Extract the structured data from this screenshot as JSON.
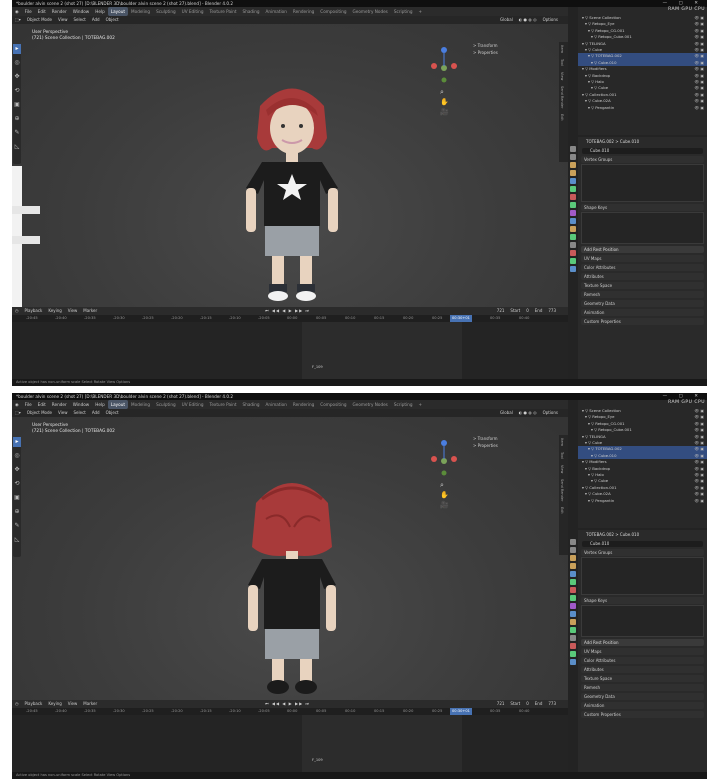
{
  "shots": [
    {
      "id": "shot1",
      "title": "*boulder alvin scene 2 (shot 27) [D:\\BLENDER 3D\\boulder alvin scene 2 (shot 27).blend] - Blender 4.0.2",
      "menu": [
        "File",
        "Edit",
        "Render",
        "Window",
        "Help"
      ],
      "workspaces": [
        "Layout",
        "Modeling",
        "Sculpting",
        "UV Editing",
        "Texture Paint",
        "Shading",
        "Animation",
        "Rendering",
        "Compositing",
        "Geometry Nodes",
        "Scripting",
        "+"
      ],
      "active_workspace": "Layout",
      "vp_header": {
        "mode": "Object Mode",
        "view": "View",
        "select": "Select",
        "add": "Add",
        "object": "Object",
        "transform": "Global",
        "options": "Options"
      },
      "perspective": "User Perspective",
      "collection": "(721) Scene Collection | TOTEBAG.002",
      "npanel": [
        "> Transform",
        "> Properties"
      ],
      "ntabs": [
        "Item",
        "Tool",
        "View",
        "Send Render",
        "Edit"
      ],
      "timeline": {
        "menu": [
          "Playback",
          "Keying",
          "View",
          "Marker"
        ],
        "current": "721",
        "start_label": "Start",
        "start": "0",
        "end_label": "End",
        "end": "773",
        "ticks": [
          "-20:45",
          "-20:40",
          "-20:35",
          "-20:30",
          "-20:25",
          "-20:20",
          "-20:15",
          "-20:10",
          "-20:05",
          "00:00",
          "00:05",
          "00:10",
          "00:15",
          "00:20",
          "00:25",
          "00:30",
          "00:35",
          "00:40"
        ],
        "playhead_label": "00:30+01",
        "marker": "F_109"
      },
      "status": "Active object has non-uniform scale   Select   Rotate View   Options",
      "perf": "RAM  GPU  CPU",
      "outliner": [
        "Scene Collection",
        "Retopo_Eye",
        "Retopo_CG.001",
        "Retopo_Cube.001",
        "TELINGA",
        "Cube",
        "TOTEBAG.002",
        "Cube.010",
        "Modifiers",
        "Backdrop",
        "Halo",
        "Cube",
        "Collection.001",
        "Cube.02A",
        "Pengantin"
      ],
      "breadcrumb": "TOTEBAG.002 > Cube.010",
      "mesh": "Cube.010",
      "panels": {
        "vertex_groups": "Vertex Groups",
        "shape_keys": "Shape Keys",
        "add_rest": "Add Rest Position",
        "uv": "UV Maps",
        "color": "Color Attributes",
        "attributes": "Attributes",
        "texture": "Texture Space",
        "remesh": "Remesh",
        "geometry": "Geometry Data",
        "animation": "Animation",
        "custom": "Custom Properties"
      }
    },
    {
      "id": "shot2",
      "title": "*boulder alvin scene 2 (shot 27) [D:\\BLENDER 3D\\boulder alvin scene 2 (shot 27).blend] - Blender 4.0.2",
      "menu": [
        "File",
        "Edit",
        "Render",
        "Window",
        "Help"
      ],
      "workspaces": [
        "Layout",
        "Modeling",
        "Sculpting",
        "UV Editing",
        "Texture Paint",
        "Shading",
        "Animation",
        "Rendering",
        "Compositing",
        "Geometry Nodes",
        "Scripting",
        "+"
      ],
      "active_workspace": "Layout",
      "vp_header": {
        "mode": "Object Mode",
        "view": "View",
        "select": "Select",
        "add": "Add",
        "object": "Object",
        "transform": "Global",
        "options": "Options"
      },
      "perspective": "User Perspective",
      "collection": "(721) Scene Collection | TOTEBAG.002",
      "npanel": [
        "> Transform",
        "> Properties"
      ],
      "ntabs": [
        "Item",
        "Tool",
        "View",
        "Send Render",
        "Edit"
      ],
      "timeline": {
        "menu": [
          "Playback",
          "Keying",
          "View",
          "Marker"
        ],
        "current": "721",
        "start_label": "Start",
        "start": "0",
        "end_label": "End",
        "end": "773",
        "ticks": [
          "-20:45",
          "-20:40",
          "-20:35",
          "-20:30",
          "-20:25",
          "-20:20",
          "-20:15",
          "-20:10",
          "-20:05",
          "00:00",
          "00:05",
          "00:10",
          "00:15",
          "00:20",
          "00:25",
          "00:30",
          "00:35",
          "00:40"
        ],
        "playhead_label": "00:30+01",
        "marker": "F_109"
      },
      "status": "Active object has non-uniform scale   Select   Rotate View   Options",
      "perf": "RAM  GPU  CPU",
      "outliner": [
        "Scene Collection",
        "Retopo_Eye",
        "Retopo_CG.001",
        "Retopo_Cube.001",
        "TELINGA",
        "Cube",
        "TOTEBAG.002",
        "Cube.010",
        "Modifiers",
        "Backdrop",
        "Halo",
        "Cube",
        "Collection.001",
        "Cube.02A",
        "Pengantin"
      ],
      "breadcrumb": "TOTEBAG.002 > Cube.010",
      "mesh": "Cube.010",
      "panels": {
        "vertex_groups": "Vertex Groups",
        "shape_keys": "Shape Keys",
        "add_rest": "Add Rest Position",
        "uv": "UV Maps",
        "color": "Color Attributes",
        "attributes": "Attributes",
        "texture": "Texture Space",
        "remesh": "Remesh",
        "geometry": "Geometry Data",
        "animation": "Animation",
        "custom": "Custom Properties"
      }
    }
  ],
  "colors": {
    "accent": "#4772b3",
    "shirt": "#1a1a1a",
    "shorts": "#9aa0a6",
    "hair": "#a83a3a",
    "skin": "#e8d3bf"
  }
}
